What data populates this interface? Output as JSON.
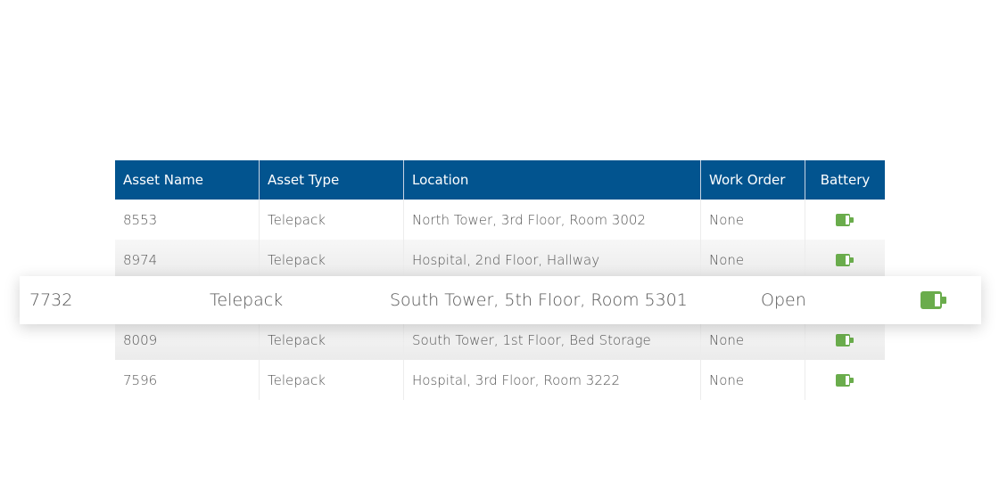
{
  "table": {
    "columns": [
      "Asset Name",
      "Asset Type",
      "Location",
      "Work Order",
      "Battery"
    ],
    "rows": [
      {
        "asset_name": "8553",
        "asset_type": "Telepack",
        "location": "North Tower, 3rd Floor, Room 3002",
        "work_order": "None",
        "battery": "battery-icon"
      },
      {
        "asset_name": "8974",
        "asset_type": "Telepack",
        "location": "Hospital, 2nd Floor, Hallway",
        "work_order": "None",
        "battery": "battery-icon"
      },
      {
        "asset_name": "7732",
        "asset_type": "Telepack",
        "location": "South Tower, 5th Floor, Room 5301",
        "work_order": "Open",
        "battery": "battery-icon"
      },
      {
        "asset_name": "8009",
        "asset_type": "Telepack",
        "location": "South Tower, 1st Floor, Bed Storage",
        "work_order": "None",
        "battery": "battery-icon"
      },
      {
        "asset_name": "7596",
        "asset_type": "Telepack",
        "location": "Hospital, 3rd Floor, Room 3222",
        "work_order": "None",
        "battery": "battery-icon"
      }
    ],
    "highlighted_row_index": 2
  },
  "colors": {
    "header_bg": "#02548f",
    "battery_green": "#6aac4c"
  }
}
